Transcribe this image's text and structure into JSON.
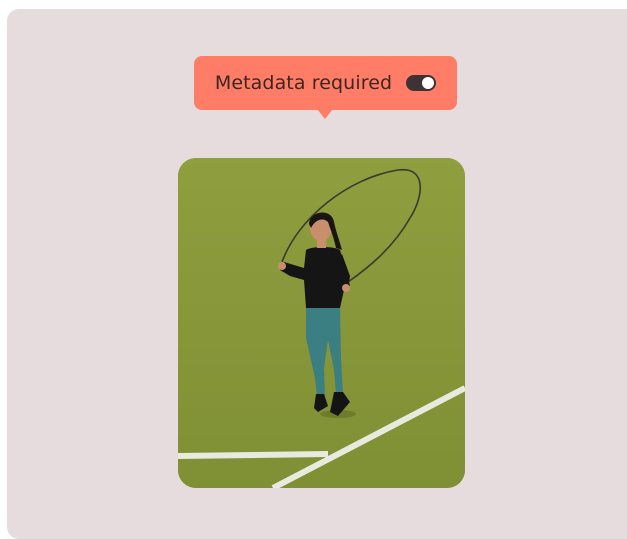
{
  "metadata_tooltip": {
    "label": "Metadata required",
    "toggle_on": true
  },
  "colors": {
    "panel_background": "#e6dcdd",
    "tooltip_background": "#ff7d66",
    "toggle_track": "#3d3234",
    "turf_green": "#8a9a3c"
  },
  "photo": {
    "subject": "woman jumping rope on green sports field"
  }
}
